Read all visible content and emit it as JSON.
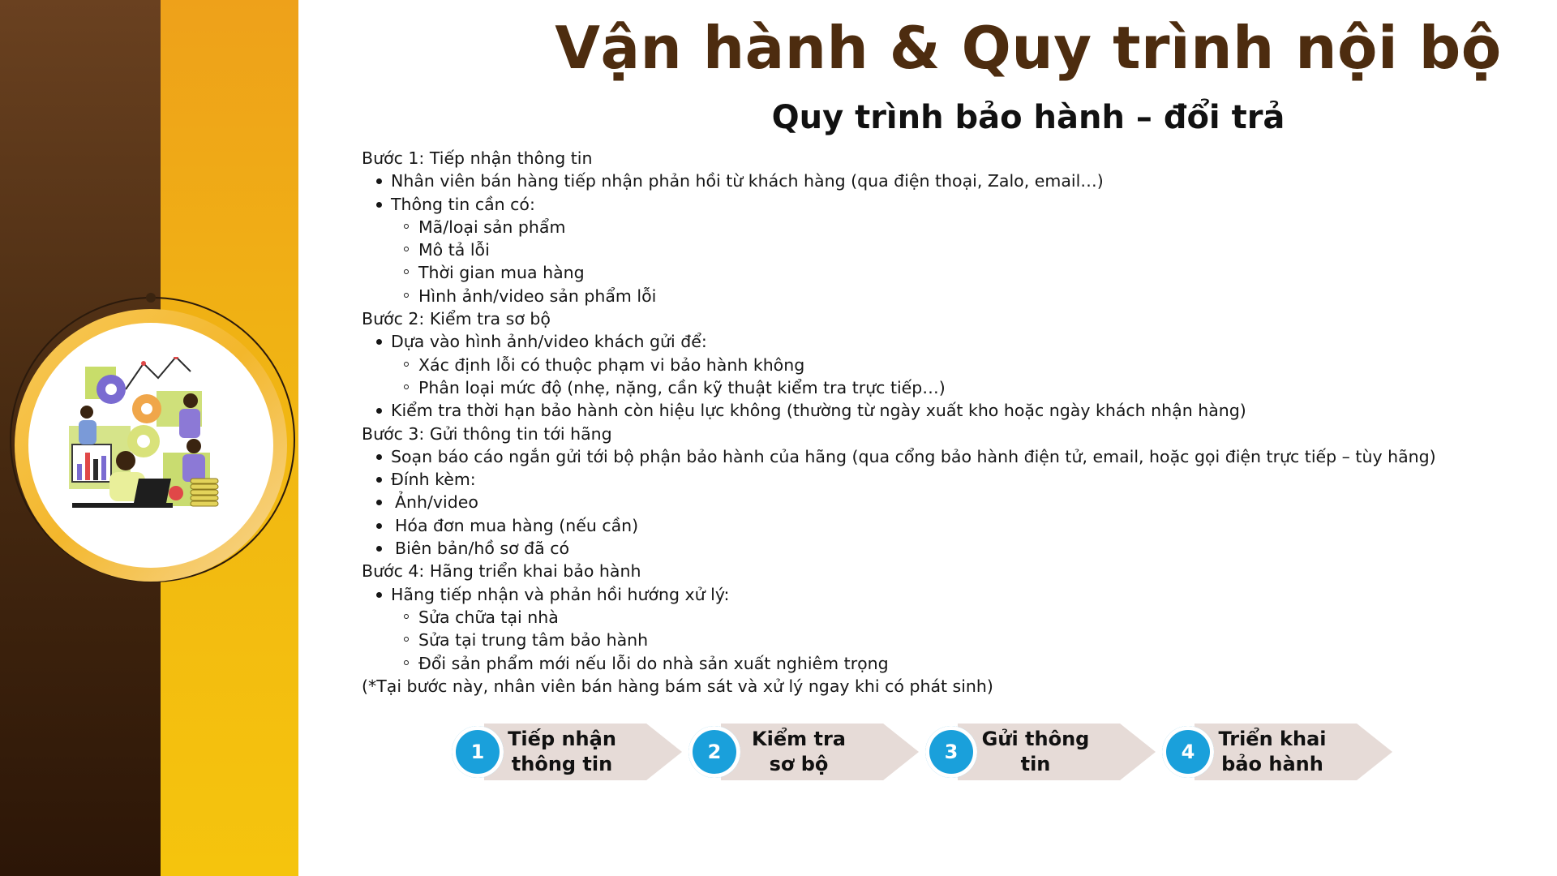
{
  "header": {
    "title": "Vận hành & Quy trình nội bộ",
    "subtitle": "Quy trình bảo hành – đổi trả"
  },
  "colors": {
    "brown": "#4d2c0f",
    "yellow": "#f1b712",
    "step_badge": "#1aa0db",
    "step_arrow": "#e6dbd7"
  },
  "illustration": {
    "icon": "team-analytics-illustration"
  },
  "content": {
    "lines": [
      {
        "level": "step",
        "text": "Bước 1: Tiếp nhận thông tin"
      },
      {
        "level": "bullet",
        "text": "Nhân viên bán hàng tiếp nhận phản hồi từ khách hàng (qua điện thoại, Zalo, email…)"
      },
      {
        "level": "bullet",
        "text": "Thông tin cần có:"
      },
      {
        "level": "sub",
        "text": "Mã/loại sản phẩm"
      },
      {
        "level": "sub",
        "text": "Mô tả lỗi"
      },
      {
        "level": "sub",
        "text": "Thời gian mua hàng"
      },
      {
        "level": "sub",
        "text": "Hình ảnh/video sản phẩm lỗi"
      },
      {
        "level": "step",
        "text": "Bước 2: Kiểm tra sơ bộ"
      },
      {
        "level": "bullet",
        "text": "Dựa vào hình ảnh/video khách gửi để:"
      },
      {
        "level": "sub",
        "text": "Xác định lỗi có thuộc phạm vi bảo hành không"
      },
      {
        "level": "sub",
        "text": "Phân loại mức độ (nhẹ, nặng, cần kỹ thuật kiểm tra trực tiếp…)"
      },
      {
        "level": "bullet",
        "text": "Kiểm tra thời hạn bảo hành còn hiệu lực không (thường từ ngày xuất kho hoặc ngày khách nhận hàng)"
      },
      {
        "level": "step",
        "text": "Bước 3: Gửi thông tin tới hãng"
      },
      {
        "level": "bullet",
        "text": "Soạn báo cáo ngắn gửi tới bộ phận bảo hành của hãng (qua cổng bảo hành điện tử, email, hoặc gọi điện trực tiếp – tùy hãng)"
      },
      {
        "level": "bullet",
        "text": "Đính kèm:"
      },
      {
        "level": "bullet-s",
        "text": "Ảnh/video"
      },
      {
        "level": "bullet-s",
        "text": "Hóa đơn mua hàng (nếu cần)"
      },
      {
        "level": "bullet-s",
        "text": "Biên bản/hồ sơ đã có"
      },
      {
        "level": "step",
        "text": "Bước 4: Hãng triển khai bảo hành"
      },
      {
        "level": "bullet",
        "text": "Hãng tiếp nhận và phản hồi hướng xử lý:"
      },
      {
        "level": "sub",
        "text": "Sửa chữa tại nhà"
      },
      {
        "level": "sub",
        "text": "Sửa tại trung tâm bảo hành"
      },
      {
        "level": "sub",
        "text": "Đổi sản phẩm mới nếu lỗi do nhà sản xuất nghiêm trọng"
      },
      {
        "level": "step",
        "text": "(*Tại bước này, nhân viên bán hàng bám sát và xử lý ngay khi có phát sinh)"
      }
    ]
  },
  "process": {
    "steps": [
      {
        "number": "1",
        "line1": "Tiếp nhận",
        "line2": "thông tin"
      },
      {
        "number": "2",
        "line1": "Kiểm tra",
        "line2": "sơ bộ"
      },
      {
        "number": "3",
        "line1": "Gửi thông",
        "line2": "tin"
      },
      {
        "number": "4",
        "line1": "Triển khai",
        "line2": "bảo hành"
      }
    ]
  }
}
